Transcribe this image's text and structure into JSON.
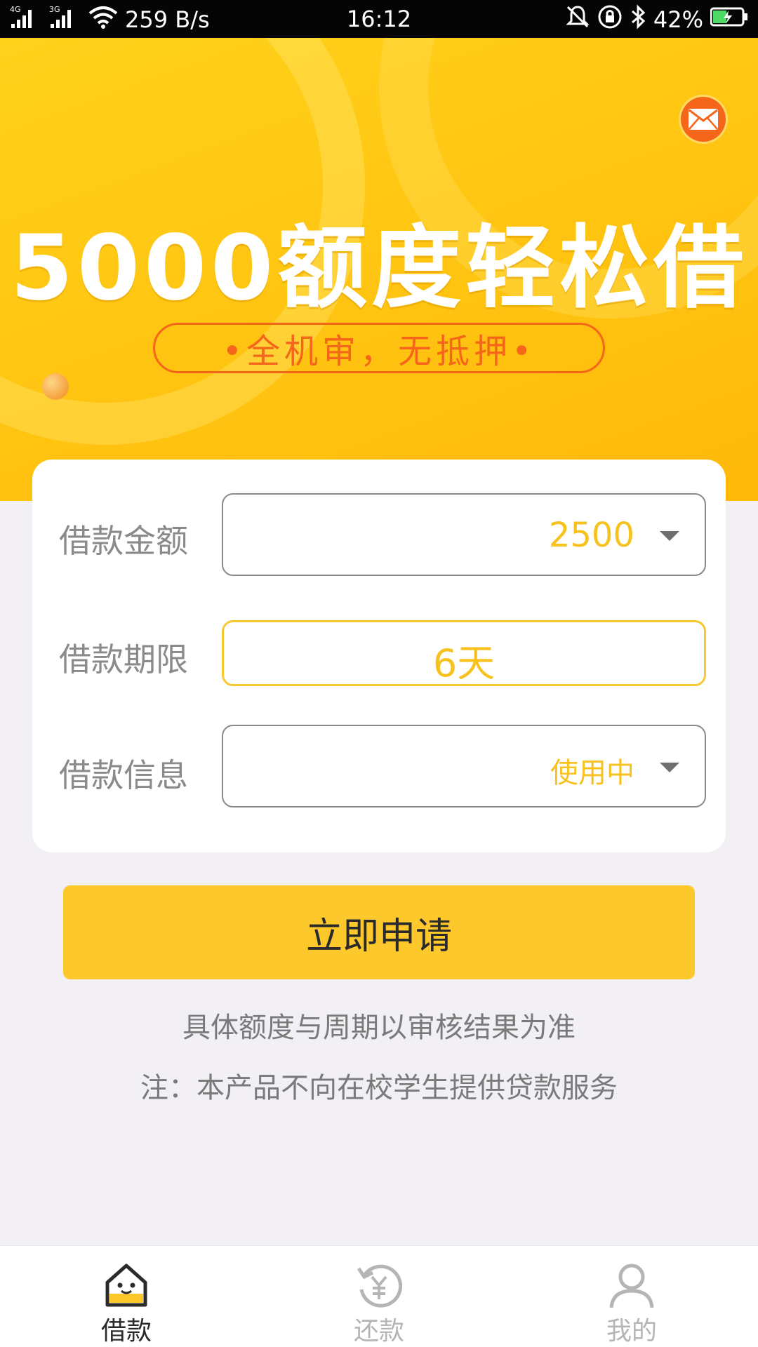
{
  "status_bar": {
    "network_1": "4G",
    "network_2": "3G",
    "speed": "259 B/s",
    "time": "16:12",
    "battery": "42%"
  },
  "banner": {
    "headline": "5000额度轻松借",
    "subtitle": "•全机审，无抵押•"
  },
  "form": {
    "amount": {
      "label": "借款金额",
      "value": "2500"
    },
    "term": {
      "label": "借款期限",
      "value": "6天"
    },
    "info": {
      "label": "借款信息",
      "value": "使用中"
    }
  },
  "apply_button": {
    "label": "立即申请"
  },
  "notes": {
    "line1": "具体额度与周期以审核结果为准",
    "line2": "注：本产品不向在校学生提供贷款服务"
  },
  "nav": {
    "items": [
      {
        "label": "借款",
        "icon": "house-icon",
        "active": true
      },
      {
        "label": "还款",
        "icon": "repay-yen-icon",
        "active": false
      },
      {
        "label": "我的",
        "icon": "user-icon",
        "active": false
      }
    ]
  },
  "colors": {
    "accent": "#fcc82c",
    "accent_text": "#f8c21e",
    "orange": "#f5661a",
    "inactive": "#b5b5b5"
  }
}
